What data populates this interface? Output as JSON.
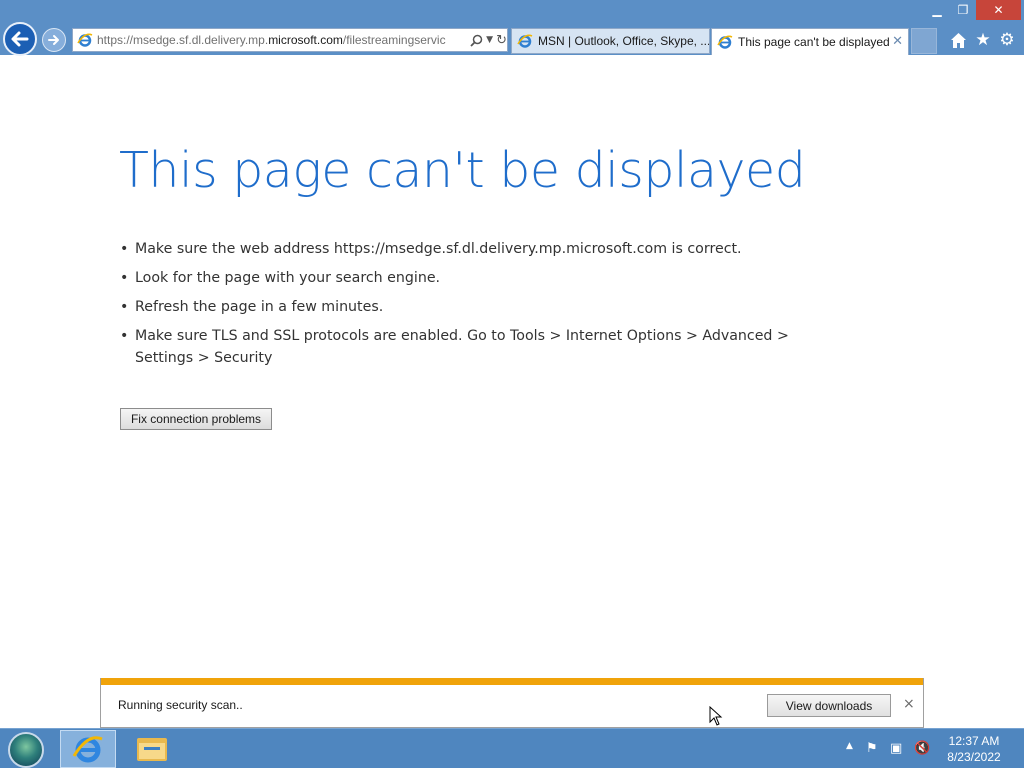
{
  "browser": {
    "address": {
      "prefix": "https://msedge.sf.dl.delivery.mp.",
      "domain": "microsoft.com",
      "suffix": "/filestreamingservic"
    },
    "tabs": [
      {
        "label": "MSN | Outlook, Office, Skype, ..."
      },
      {
        "label": "This page can't be displayed"
      }
    ]
  },
  "page": {
    "title": "This page can't be displayed",
    "tips": [
      "Make sure the web address https://msedge.sf.dl.delivery.mp.microsoft.com is correct.",
      "Look for the page with your search engine.",
      "Refresh the page in a few minutes.",
      "Make sure TLS and SSL protocols are enabled. Go to Tools > Internet Options > Advanced > Settings > Security"
    ],
    "fix_button": "Fix connection problems"
  },
  "notification": {
    "message": "Running security scan..",
    "button": "View downloads",
    "close": "×"
  },
  "taskbar": {
    "time": "12:37 AM",
    "date": "8/23/2022"
  },
  "colors": {
    "title_blue": "#1f6dcb",
    "chrome_blue": "#5b8fc6",
    "progress_orange": "#f0a30a"
  }
}
